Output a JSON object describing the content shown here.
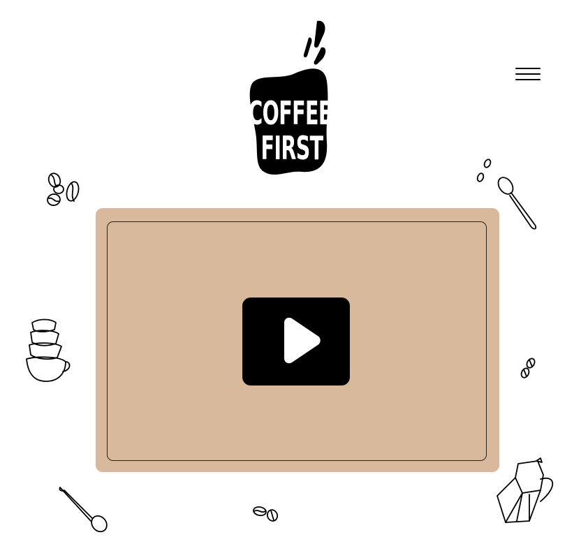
{
  "logo": {
    "line1": "COFFEE",
    "line2": "FIRST"
  },
  "header": {
    "menu_icon": "hamburger-menu-icon"
  },
  "video": {
    "play_icon": "play-icon",
    "card_color": "#d8b99c"
  },
  "decorations": [
    "coffee-beans-icon",
    "spoon-icon",
    "stacked-cups-icon",
    "coffee-beans-icon",
    "spoon-icon",
    "coffee-beans-icon",
    "moka-pot-icon"
  ]
}
